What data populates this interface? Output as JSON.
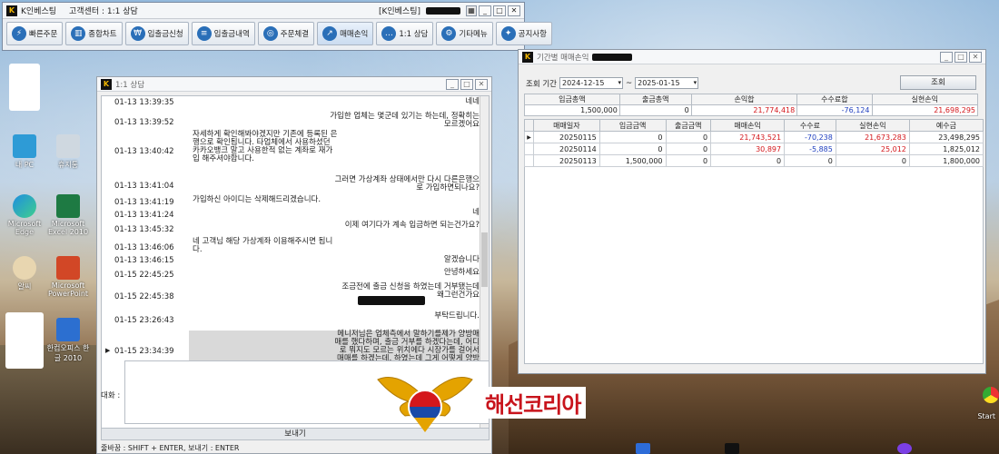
{
  "app": {
    "title": "K인베스팅",
    "support_title": "고객센터 : 1:1 상담",
    "right_title": "[K인베스팅]",
    "toolbar": [
      {
        "label": "빠른주문",
        "icon": "quick-order-icon"
      },
      {
        "label": "종합차트",
        "icon": "chart-icon"
      },
      {
        "label": "입출금신청",
        "icon": "deposit-withdraw-icon"
      },
      {
        "label": "입출금내역",
        "icon": "history-icon"
      },
      {
        "label": "주문체결",
        "icon": "order-fill-icon"
      },
      {
        "label": "매매손익",
        "icon": "profit-loss-icon"
      },
      {
        "label": "1:1 상담",
        "icon": "chat-icon"
      },
      {
        "label": "기타메뉴",
        "icon": "gear-icon"
      },
      {
        "label": "공지사항",
        "icon": "megaphone-icon"
      }
    ]
  },
  "desktop": {
    "icons": [
      {
        "label": "내 PC"
      },
      {
        "label": "휴지통"
      },
      {
        "label": "Microsoft Edge"
      },
      {
        "label": "Microsoft Excel 2010"
      },
      {
        "label": "알씨"
      },
      {
        "label": "Microsoft PowerPoint"
      },
      {
        "label": "한컴오피스 한글 2010"
      }
    ],
    "start_label": "Start"
  },
  "chat": {
    "title": "1:1 상담",
    "rows": [
      {
        "time": "01-13 13:39:35",
        "left": "",
        "right": "네네"
      },
      {
        "time": "01-13 13:39:52",
        "left": "",
        "right": "가입한 업체는 몇군데 있기는 하는데, 정확히는 모르겠어요"
      },
      {
        "time": "01-13 13:40:42",
        "left": "자세하게 확인해봐야겠지만 기존에 등록된 은행으로 확인됩니다. 타업체에서 사용하셨던 카카오뱅크 말고 사용한적 없는 계좌로 재가입 해주셔야합니다.",
        "right": ""
      },
      {
        "time": "01-13 13:41:04",
        "left": "",
        "right": "그러면 가상계좌 상태에서만 다시 다른은행으로 가입하면되나요?"
      },
      {
        "time": "01-13 13:41:19",
        "left": "가입하신 아이디는 삭제해드리겠습니다.",
        "right": ""
      },
      {
        "time": "01-13 13:41:24",
        "left": "",
        "right": "네"
      },
      {
        "time": "01-13 13:45:32",
        "left": "",
        "right": "이제 여기다가 계속 입금하면 되는건가요?"
      },
      {
        "time": "01-13 13:46:06",
        "left": "네 고객님 해당 가상계좌 이용해주시면 됩니다.",
        "right": ""
      },
      {
        "time": "01-13 13:46:15",
        "left": "",
        "right": "알겠습니다"
      },
      {
        "time": "01-15 22:45:25",
        "left": "",
        "right": "안녕하세요"
      },
      {
        "time": "01-15 22:45:38",
        "left": "",
        "right": "조금전에 출금 신청을 하였는데 거부됐는데 왜그런건가요"
      },
      {
        "time": "01-15 23:26:43",
        "left": "",
        "right": "부탁드립니다."
      },
      {
        "time": "01-15 23:34:39",
        "left": "",
        "right": "메니저님은 업체측에서 말하기를제가 양방매매를 했다하며, 출금 거부를 하겠다는데, 어디로 뭐지도 모르는 위치에다 시장가를 걸어서 매매를 하겠는데, 하였는데 그게 어떻게 양방매매가 되나요"
      }
    ],
    "input_label": "대화 :",
    "send_label": "보내기",
    "hint": "줄바꿈 : SHIFT + ENTER, 보내기 : ENTER"
  },
  "pnl": {
    "title": "기간별 매매손익",
    "search_label": "조회 기간",
    "date_from": "2024-12-15",
    "date_to": "2025-01-15",
    "tilde": "~",
    "query_button": "조회",
    "summary_headers": [
      "입금총액",
      "출금총액",
      "손익합",
      "수수료합",
      "실현손익"
    ],
    "summary_values": [
      "1,500,000",
      "0",
      "21,774,418",
      "-76,124",
      "21,698,295"
    ],
    "columns": [
      "매매일자",
      "입금금액",
      "출금금액",
      "매매손익",
      "수수료",
      "실현손익",
      "예수금"
    ],
    "rows": [
      [
        "20250115",
        "0",
        "0",
        "21,743,521",
        "-70,238",
        "21,673,283",
        "23,498,295"
      ],
      [
        "20250114",
        "0",
        "0",
        "30,897",
        "-5,885",
        "25,012",
        "1,825,012"
      ],
      [
        "20250113",
        "1,500,000",
        "0",
        "0",
        "0",
        "0",
        "1,800,000"
      ]
    ]
  },
  "watermark": {
    "text": "해선코리아"
  },
  "colors": {
    "profit": "#d4171c",
    "fee": "#1f3fbf",
    "logo_red": "#c8141c"
  }
}
